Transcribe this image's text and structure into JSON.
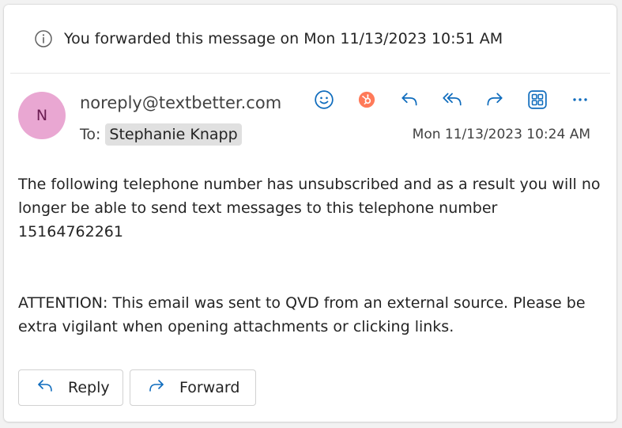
{
  "banner": {
    "text": "You forwarded this message on Mon 11/13/2023 10:51 AM",
    "icon": "info-icon"
  },
  "message": {
    "avatar_initial": "N",
    "sender": "noreply@textbetter.com",
    "to_label": "To:",
    "recipient": "Stephanie Knapp",
    "timestamp": "Mon 11/13/2023 10:24 AM",
    "body_paragraph_1": "The following telephone number has unsubscribed and as a result you will no longer be able to send text messages to this telephone number 15164762261",
    "body_paragraph_2": "ATTENTION: This email was sent to QVD from an external source. Please be extra vigilant when opening attachments or clicking links."
  },
  "actions": [
    {
      "name": "emoji-icon"
    },
    {
      "name": "hubspot-icon"
    },
    {
      "name": "reply-icon"
    },
    {
      "name": "reply-all-icon"
    },
    {
      "name": "forward-icon"
    },
    {
      "name": "apps-icon"
    },
    {
      "name": "more-icon"
    }
  ],
  "footer": {
    "reply_label": "Reply",
    "forward_label": "Forward"
  },
  "colors": {
    "accent": "#0f6cbd",
    "hubspot": "#ff7a59",
    "avatar_bg": "#e9a7d2",
    "avatar_fg": "#6b1d52"
  }
}
